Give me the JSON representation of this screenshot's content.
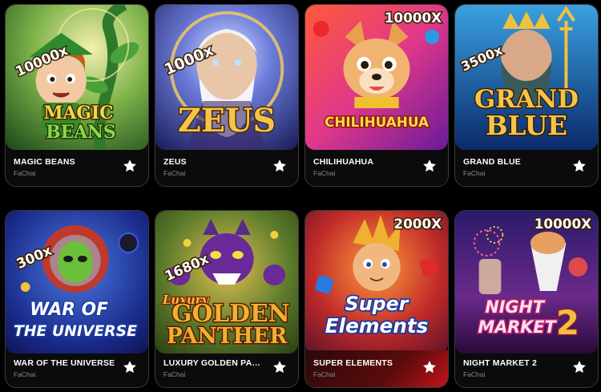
{
  "games": [
    {
      "name": "MAGIC BEANS",
      "provider": "FaChai",
      "multiplier": "10000x",
      "logo": [
        "MAGIC",
        "BEANS"
      ],
      "favorite_icon": "star-icon"
    },
    {
      "name": "ZEUS",
      "provider": "FaChai",
      "multiplier": "1000x",
      "logo": [
        "ZEUS"
      ],
      "favorite_icon": "star-icon"
    },
    {
      "name": "CHILIHUAHUA",
      "provider": "FaChai",
      "multiplier": "10000X",
      "logo": [
        "CHILIHUAHUA"
      ],
      "favorite_icon": "star-icon"
    },
    {
      "name": "GRAND BLUE",
      "provider": "FaChai",
      "multiplier": "3500x",
      "logo": [
        "GRAND",
        "BLUE"
      ],
      "favorite_icon": "star-icon"
    },
    {
      "name": "WAR OF THE UNIVERSE",
      "provider": "FaChai",
      "multiplier": "300x",
      "logo": [
        "WAR OF",
        "THE UNIVERSE"
      ],
      "favorite_icon": "star-icon"
    },
    {
      "name": "LUXURY GOLDEN PANTHER",
      "provider": "FaChai",
      "multiplier": "1680x",
      "logo": [
        "Luxury",
        "GOLDEN",
        "PANTHER"
      ],
      "favorite_icon": "star-icon"
    },
    {
      "name": "SUPER ELEMENTS",
      "provider": "FaChai",
      "multiplier": "2000X",
      "logo": [
        "Super",
        "Elements"
      ],
      "favorite_icon": "star-icon"
    },
    {
      "name": "NIGHT MARKET 2",
      "provider": "FaChai",
      "multiplier": "10000X",
      "logo": [
        "NIGHT",
        "MARKET",
        "2"
      ],
      "favorite_icon": "star-icon"
    }
  ],
  "colors": {
    "background": "#000000",
    "card_bg": "#0b0b0b",
    "card_border": "#3a3a3a",
    "provider_text": "#8a8a8a",
    "highlight": "#c4141b"
  }
}
